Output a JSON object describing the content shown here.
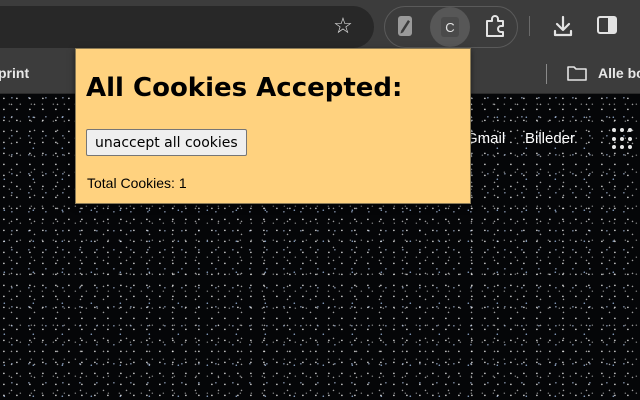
{
  "toolbar": {
    "bookmark_star_icon": "star-outline-icon",
    "extensions": [
      {
        "icon": "pencil-extension-icon"
      },
      {
        "icon": "cookie-extension-icon",
        "letter": "C",
        "active": true
      },
      {
        "icon": "puzzle-extensions-icon"
      }
    ],
    "download_icon": "download-icon",
    "side_panel_icon": "side-panel-icon"
  },
  "bookmarks_bar": {
    "items": [
      "print",
      "Alle bo"
    ],
    "folder_icon": "folder-icon"
  },
  "new_tab_page": {
    "links": [
      "Gmail",
      "Billeder"
    ],
    "apps_icon": "apps-grid-icon"
  },
  "popup": {
    "title": "All Cookies Accepted:",
    "button_label": "unaccept all cookies",
    "total_label": "Total Cookies: 1",
    "background_color": "#ffd27f"
  }
}
